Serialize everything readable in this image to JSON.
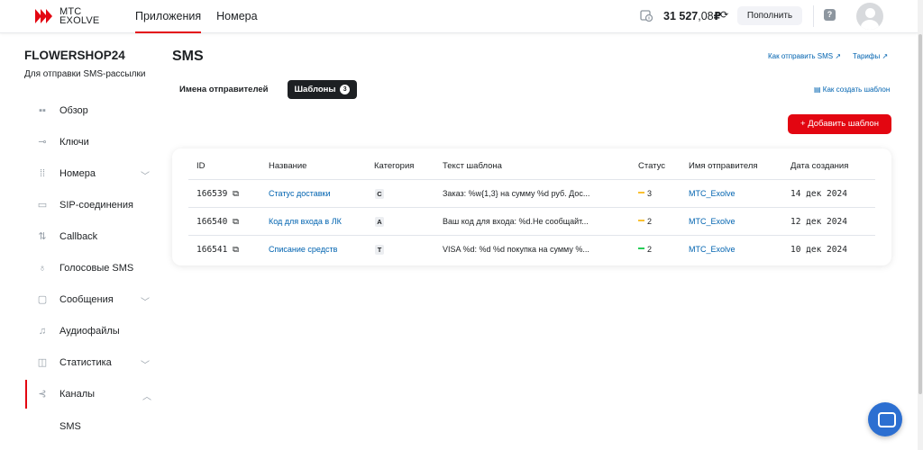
{
  "brand": {
    "line1": "МТС",
    "line2": "EXOLVE",
    "color": "#e30611"
  },
  "nav": [
    {
      "label": "Приложения",
      "active": true
    },
    {
      "label": "Номера",
      "active": false
    }
  ],
  "account": {
    "balance_main": "31 527",
    "balance_kop": ",08",
    "currency": "₽",
    "topup_label": "Пополнить"
  },
  "sidebar": {
    "company": "FLOWERSHOP24",
    "description": "Для отправки SMS-рассылки",
    "items": [
      {
        "label": "Обзор",
        "icon": "grid-icon"
      },
      {
        "label": "Ключи",
        "icon": "key-icon"
      },
      {
        "label": "Номера",
        "icon": "dialpad-icon",
        "expandable": true
      },
      {
        "label": "SIP-соединения",
        "icon": "sip-icon"
      },
      {
        "label": "Callback",
        "icon": "callback-icon"
      },
      {
        "label": "Голосовые SMS",
        "icon": "microphone-icon"
      },
      {
        "label": "Сообщения",
        "icon": "message-icon",
        "expandable": true
      },
      {
        "label": "Аудиофайлы",
        "icon": "music-icon"
      },
      {
        "label": "Статистика",
        "icon": "chart-icon",
        "expandable": true
      },
      {
        "label": "Каналы",
        "icon": "channels-icon",
        "expandable": true,
        "expanded": true,
        "active": true
      }
    ],
    "sub_items": [
      "SMS"
    ]
  },
  "main": {
    "title": "SMS",
    "links": [
      "Как отправить SMS",
      "Тарифы"
    ],
    "tabs": [
      {
        "label": "Имена отправителей",
        "active": false
      },
      {
        "label": "Шаблоны",
        "active": true,
        "count": "3"
      }
    ],
    "how_create_label": "Как создать шаблон",
    "add_button_label": "Добавить шаблон",
    "table": {
      "columns": [
        "ID",
        "Название",
        "Категория",
        "Текст шаблона",
        "Статус",
        "Имя отправителя",
        "Дата создания"
      ],
      "rows": [
        {
          "id": "166539",
          "name": "Статус доставки",
          "category": "С",
          "text": "Заказ: %w{1,3} на сумму %d руб. Дос...",
          "status": "3",
          "status_color": "#fac031",
          "sender": "MTC_Exolve",
          "date": "14 дек 2024"
        },
        {
          "id": "166540",
          "name": "Код для входа в ЛК",
          "category": "А",
          "text": "Ваш код для входа: %d.Не сообщайт...",
          "status": "2",
          "status_color": "#fac031",
          "sender": "MTC_Exolve",
          "date": "12 дек 2024"
        },
        {
          "id": "166541",
          "name": "Списание средств",
          "category": "Т",
          "text": "VISA %d: %d %d покупка на сумму %...",
          "status": "2",
          "status_color": "#26cd58",
          "sender": "MTC_Exolve",
          "date": "10 дек 2024"
        }
      ]
    }
  }
}
